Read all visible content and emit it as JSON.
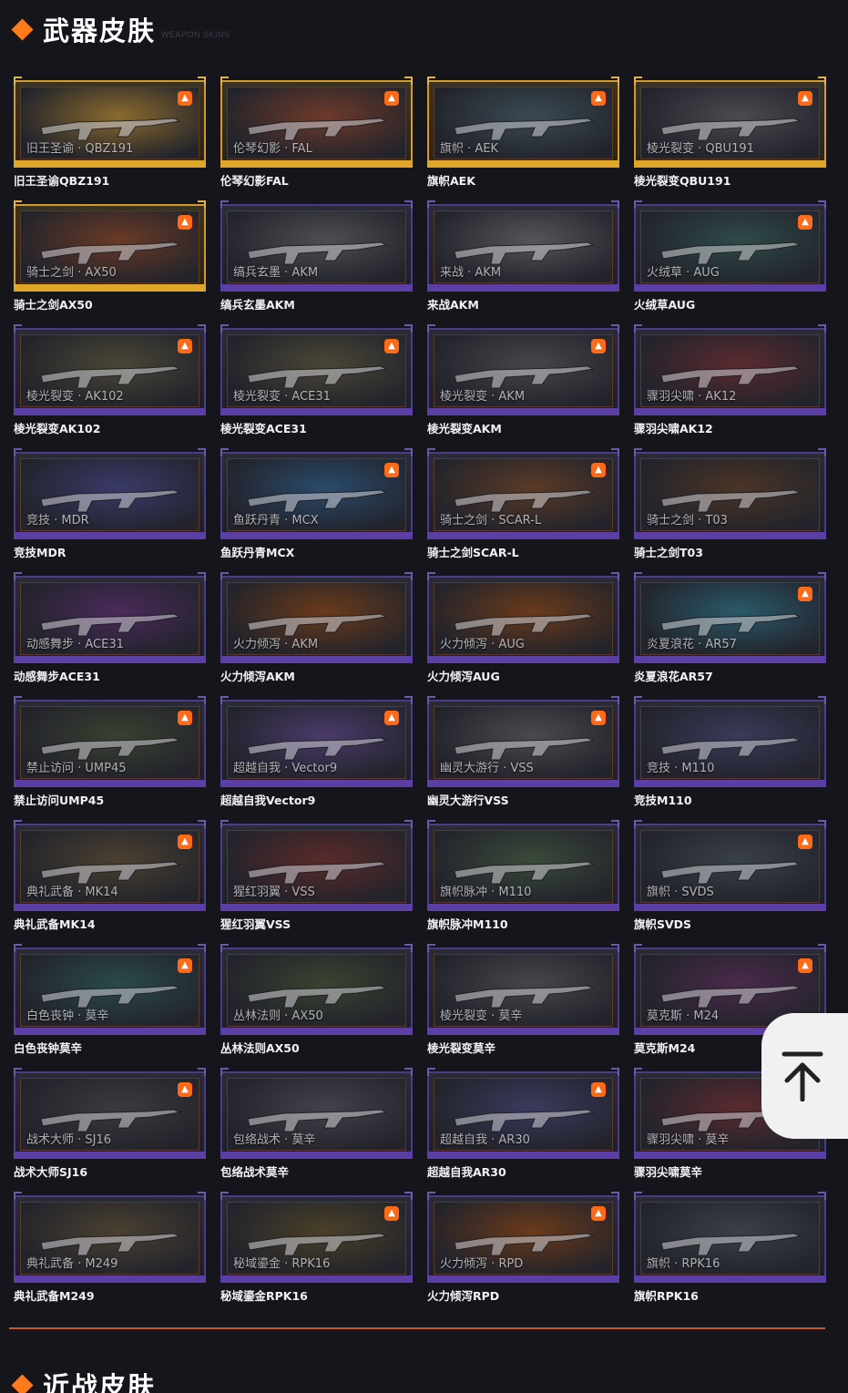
{
  "section_weapons": {
    "title": "武器皮肤",
    "subtitle": "WEAPON SKINS"
  },
  "section_melee": {
    "title": "近战皮肤"
  },
  "colors": {
    "accent": "#ff7a1a",
    "gold_frame": "#d39a2b",
    "purple_frame": "#4a3c86",
    "background": "#15161c"
  },
  "icons": {
    "section_marker": "diamond-icon",
    "badge": "flame-icon",
    "scroll_top": "arrow-up-to-top-icon"
  },
  "skins": [
    {
      "label": "旧王圣谕 · QBZ191",
      "caption": "旧王圣谕QBZ191",
      "tier": "gold",
      "badge": true,
      "hue": "#8a6a2e"
    },
    {
      "label": "伦琴幻影 · FAL",
      "caption": "伦琴幻影FAL",
      "tier": "gold",
      "badge": true,
      "hue": "#6e3a2a"
    },
    {
      "label": "旗帜 · AEK",
      "caption": "旗帜AEK",
      "tier": "gold",
      "badge": true,
      "hue": "#3a4a52"
    },
    {
      "label": "棱光裂变 · QBU191",
      "caption": "棱光裂变QBU191",
      "tier": "gold",
      "badge": true,
      "hue": "#4a4a50"
    },
    {
      "label": "骑士之剑 · AX50",
      "caption": "骑士之剑AX50",
      "tier": "gold",
      "badge": true,
      "hue": "#6a3a26"
    },
    {
      "label": "缟兵玄墨 · AKM",
      "caption": "缟兵玄墨AKM",
      "tier": "purple",
      "badge": false,
      "hue": "#4e4e52"
    },
    {
      "label": "来战 · AKM",
      "caption": "来战AKM",
      "tier": "purple",
      "badge": false,
      "hue": "#55555a"
    },
    {
      "label": "火绒草 · AUG",
      "caption": "火绒草AUG",
      "tier": "purple",
      "badge": true,
      "hue": "#2e4a48"
    },
    {
      "label": "棱光裂变 · AK102",
      "caption": "棱光裂变AK102",
      "tier": "purple",
      "badge": true,
      "hue": "#4a4636"
    },
    {
      "label": "棱光裂变 · ACE31",
      "caption": "棱光裂变ACE31",
      "tier": "purple",
      "badge": true,
      "hue": "#4a4636"
    },
    {
      "label": "棱光裂变 · AKM",
      "caption": "棱光裂变AKM",
      "tier": "purple",
      "badge": true,
      "hue": "#46464a"
    },
    {
      "label": "骤羽尖啸 · AK12",
      "caption": "骤羽尖啸AK12",
      "tier": "purple",
      "badge": false,
      "hue": "#5a2a30"
    },
    {
      "label": "竞技 · MDR",
      "caption": "竞技MDR",
      "tier": "purple",
      "badge": false,
      "hue": "#3a3a6a"
    },
    {
      "label": "鱼跃丹青 · MCX",
      "caption": "鱼跃丹青MCX",
      "tier": "purple",
      "badge": true,
      "hue": "#2a4a6a"
    },
    {
      "label": "骑士之剑 · SCAR-L",
      "caption": "骑士之剑SCAR-L",
      "tier": "purple",
      "badge": true,
      "hue": "#5a3a26"
    },
    {
      "label": "骑士之剑 · T03",
      "caption": "骑士之剑T03",
      "tier": "purple",
      "badge": false,
      "hue": "#4a3426"
    },
    {
      "label": "动感舞步 · ACE31",
      "caption": "动感舞步ACE31",
      "tier": "purple",
      "badge": false,
      "hue": "#4a2a5a"
    },
    {
      "label": "火力倾泻 · AKM",
      "caption": "火力倾泻AKM",
      "tier": "purple",
      "badge": false,
      "hue": "#6a3a1a"
    },
    {
      "label": "火力倾泻 · AUG",
      "caption": "火力倾泻AUG",
      "tier": "purple",
      "badge": false,
      "hue": "#6a3a1a"
    },
    {
      "label": "炎夏浪花 · AR57",
      "caption": "炎夏浪花AR57",
      "tier": "purple",
      "badge": true,
      "hue": "#2a5a6a"
    },
    {
      "label": "禁止访问 · UMP45",
      "caption": "禁止访问UMP45",
      "tier": "purple",
      "badge": true,
      "hue": "#3a4030"
    },
    {
      "label": "超越自我 · Vector9",
      "caption": "超越自我Vector9",
      "tier": "purple",
      "badge": true,
      "hue": "#4a3a6a"
    },
    {
      "label": "幽灵大游行 · VSS",
      "caption": "幽灵大游行VSS",
      "tier": "purple",
      "badge": true,
      "hue": "#4a4a4e"
    },
    {
      "label": "竞技 · M110",
      "caption": "竞技M110",
      "tier": "purple",
      "badge": false,
      "hue": "#3a3a5a"
    },
    {
      "label": "典礼武备 · MK14",
      "caption": "典礼武备MK14",
      "tier": "purple",
      "badge": true,
      "hue": "#4a4030"
    },
    {
      "label": "猩红羽翼 · VSS",
      "caption": "猩红羽翼VSS",
      "tier": "purple",
      "badge": false,
      "hue": "#5a2a2a"
    },
    {
      "label": "旗帜脉冲 · M110",
      "caption": "旗帜脉冲M110",
      "tier": "purple",
      "badge": false,
      "hue": "#3a4a3a"
    },
    {
      "label": "旗帜 · SVDS",
      "caption": "旗帜SVDS",
      "tier": "purple",
      "badge": true,
      "hue": "#3a4048"
    },
    {
      "label": "白色丧钟 · 莫辛",
      "caption": "白色丧钟莫辛",
      "tier": "purple",
      "badge": true,
      "hue": "#2a4a4a"
    },
    {
      "label": "丛林法则 · AX50",
      "caption": "丛林法则AX50",
      "tier": "purple",
      "badge": false,
      "hue": "#3a4230"
    },
    {
      "label": "棱光裂变 · 莫辛",
      "caption": "棱光裂变莫辛",
      "tier": "purple",
      "badge": false,
      "hue": "#46464a"
    },
    {
      "label": "莫克斯 · M24",
      "caption": "莫克斯M24",
      "tier": "purple",
      "badge": true,
      "hue": "#4a2a4a"
    },
    {
      "label": "战术大师 · SJ16",
      "caption": "战术大师SJ16",
      "tier": "purple",
      "badge": true,
      "hue": "#3a3a3e"
    },
    {
      "label": "包络战术 · 莫辛",
      "caption": "包络战术莫辛",
      "tier": "purple",
      "badge": false,
      "hue": "#42424a"
    },
    {
      "label": "超越自我 · AR30",
      "caption": "超越自我AR30",
      "tier": "purple",
      "badge": true,
      "hue": "#3a3a5e"
    },
    {
      "label": "骤羽尖啸 · 莫辛",
      "caption": "骤羽尖啸莫辛",
      "tier": "purple",
      "badge": false,
      "hue": "#5a2a30"
    },
    {
      "label": "典礼武备 · M249",
      "caption": "典礼武备M249",
      "tier": "purple",
      "badge": false,
      "hue": "#4a4030"
    },
    {
      "label": "秘域鎏金 · RPK16",
      "caption": "秘域鎏金RPK16",
      "tier": "purple",
      "badge": true,
      "hue": "#4a4028"
    },
    {
      "label": "火力倾泻 · RPD",
      "caption": "火力倾泻RPD",
      "tier": "purple",
      "badge": true,
      "hue": "#6a3a1a"
    },
    {
      "label": "旗帜 · RPK16",
      "caption": "旗帜RPK16",
      "tier": "purple",
      "badge": false,
      "hue": "#3a4048"
    }
  ]
}
